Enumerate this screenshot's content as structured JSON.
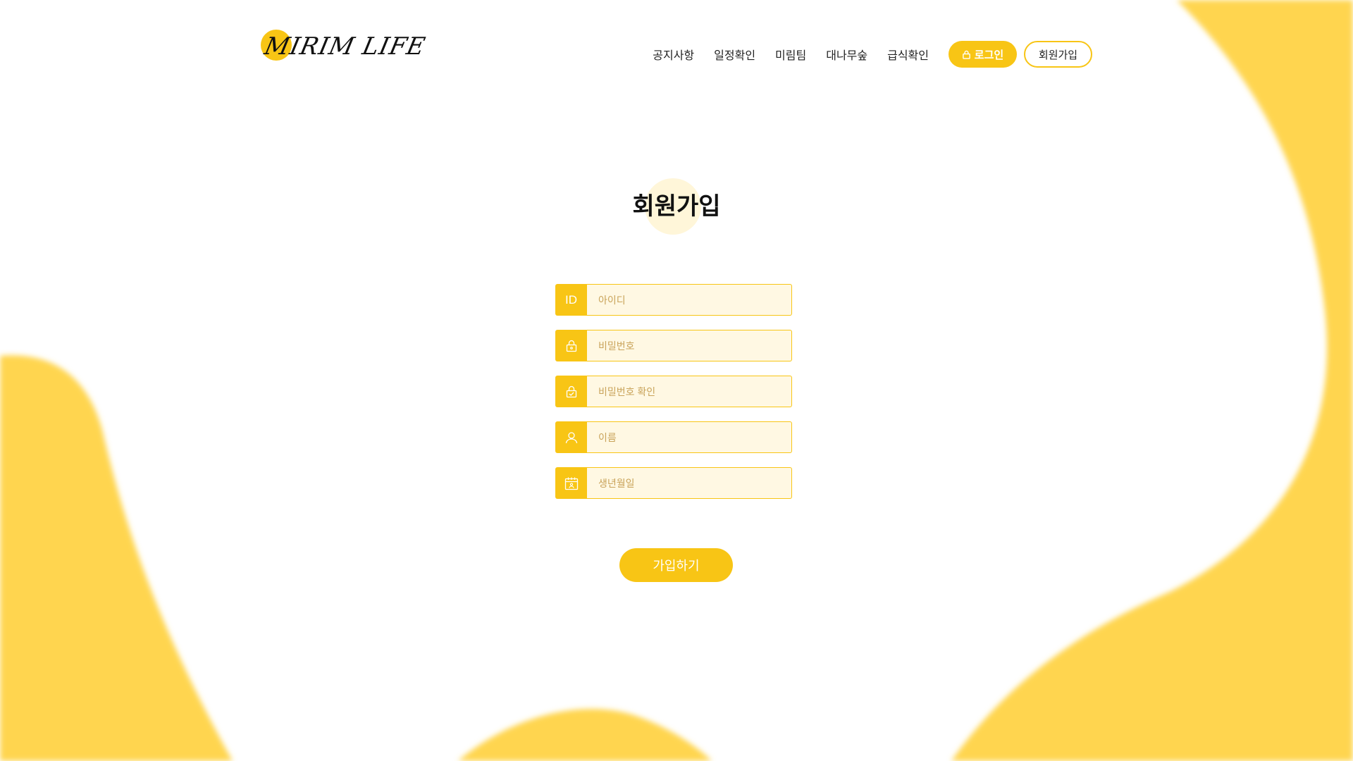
{
  "brand": {
    "logo_text": "MIRIM LIFE",
    "accent_color": "#f8c515",
    "blob_color": "#ffd54f"
  },
  "nav": {
    "items": [
      "공지사항",
      "일정확인",
      "미림팀",
      "대나무숲",
      "급식확인"
    ],
    "login_label": "로그인",
    "signup_label": "회원가입"
  },
  "page": {
    "title": "회원가입"
  },
  "form": {
    "fields": [
      {
        "icon": "id-text",
        "icon_text": "ID",
        "placeholder": "아이디",
        "value": ""
      },
      {
        "icon": "lock-icon",
        "placeholder": "비밀번호",
        "value": ""
      },
      {
        "icon": "lock-check-icon",
        "placeholder": "비밀번호 확인",
        "value": ""
      },
      {
        "icon": "user-icon",
        "placeholder": "이름",
        "value": ""
      },
      {
        "icon": "calendar-icon",
        "placeholder": "생년월일",
        "value": ""
      }
    ],
    "submit_label": "가입하기"
  }
}
